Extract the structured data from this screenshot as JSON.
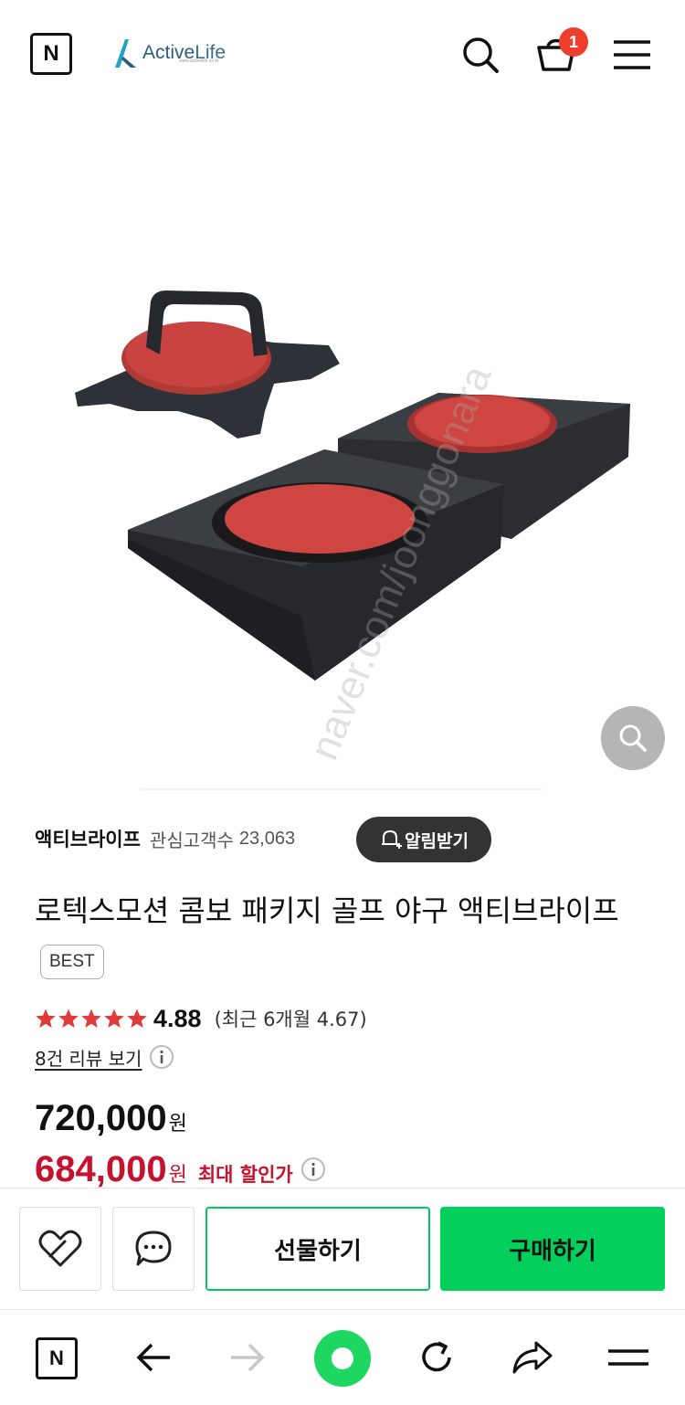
{
  "header": {
    "n_logo": "N",
    "brand_name_active": "Active",
    "brand_name_life": "Life",
    "brand_sub": "www.activelife.co.kr",
    "cart_count": "1",
    "icons": [
      "search-icon",
      "cart-icon",
      "menu-icon"
    ]
  },
  "product_image": {
    "watermark": "naver.com/joonggonara"
  },
  "store": {
    "name": "액티브라이프",
    "follower_label": "관심고객수",
    "follower_count": "23,063",
    "notify_label": "알림받기"
  },
  "product": {
    "title": "로텍스모션 콤보 패키지 골프 야구 액티브라이프",
    "badge": "BEST"
  },
  "rating": {
    "stars": 5,
    "score": "4.88",
    "recent": "(최근 6개월 4.67)",
    "review_link": "8건 리뷰 보기"
  },
  "price": {
    "original": "720,000",
    "original_unit": "원",
    "sale": "684,000",
    "sale_unit": "원",
    "sale_label": "최대 할인가"
  },
  "actions": {
    "gift_label": "선물하기",
    "buy_label": "구매하기"
  },
  "bottom_nav": {
    "n_logo": "N",
    "icons": [
      "back-icon",
      "forward-icon",
      "home-icon",
      "refresh-icon",
      "share-icon",
      "menu-icon"
    ]
  },
  "colors": {
    "accent_green": "#03cf5d",
    "sale_red": "#c4122f",
    "badge_red": "#ef3e2e",
    "star_red": "#e03a3a",
    "brand_teal": "#1fa3c8"
  }
}
